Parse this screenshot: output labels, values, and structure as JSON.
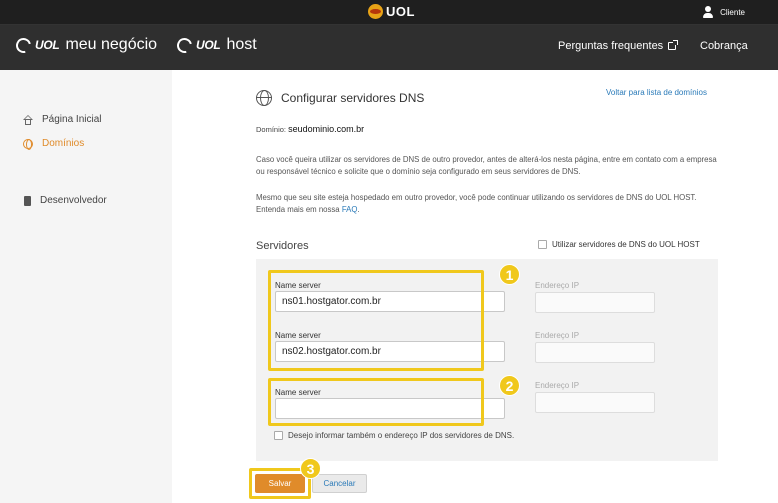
{
  "topbar": {
    "logo_text": "UOL",
    "client_label": "Cliente"
  },
  "header": {
    "brand1_uol": "UOL",
    "brand1_name": "meu negócio",
    "brand2_uol": "UOL",
    "brand2_name": "host",
    "faq_label": "Perguntas frequentes",
    "billing_label": "Cobrança"
  },
  "sidebar": {
    "items": [
      {
        "label": "Página Inicial"
      },
      {
        "label": "Domínios",
        "active": true
      },
      {
        "label": "Desenvolvedor"
      }
    ]
  },
  "page": {
    "title": "Configurar servidores DNS",
    "back_link": "Voltar para lista de domínios",
    "domain_label": "Domínio:",
    "domain_value": "seudominio.com.br",
    "para1": "Caso você queira utilizar os servidores de DNS de outro provedor, antes de alterá-los nesta página, entre em contato com a empresa ou responsável técnico e solicite que o domínio seja configurado em seus servidores de DNS.",
    "para2_text": "Mesmo que seu site esteja hospedado em outro provedor, você pode continuar utilizando os servidores de DNS do UOL HOST. Entenda mais em nossa ",
    "para2_link": "FAQ",
    "para2_end": ".",
    "servers_title": "Servidores",
    "use_uol_label": "Utilizar servidores de DNS do UOL HOST"
  },
  "servers": [
    {
      "label": "Name server",
      "value": "ns01.hostgator.com.br",
      "ip_label": "Endereço IP"
    },
    {
      "label": "Name server",
      "value": "ns02.hostgator.com.br",
      "ip_label": "Endereço IP"
    },
    {
      "label": "Name server",
      "value": "",
      "ip_label": "Endereço IP"
    }
  ],
  "ip_check_label": "Desejo informar também o endereço IP dos servidores de DNS.",
  "badges": [
    "1",
    "2",
    "3"
  ],
  "buttons": {
    "save": "Salvar",
    "cancel": "Cancelar"
  },
  "colors": {
    "accent": "#e08b2a",
    "highlight": "#f0c81c",
    "link": "#2a7ab8",
    "header_bg": "#2f2f2f"
  }
}
